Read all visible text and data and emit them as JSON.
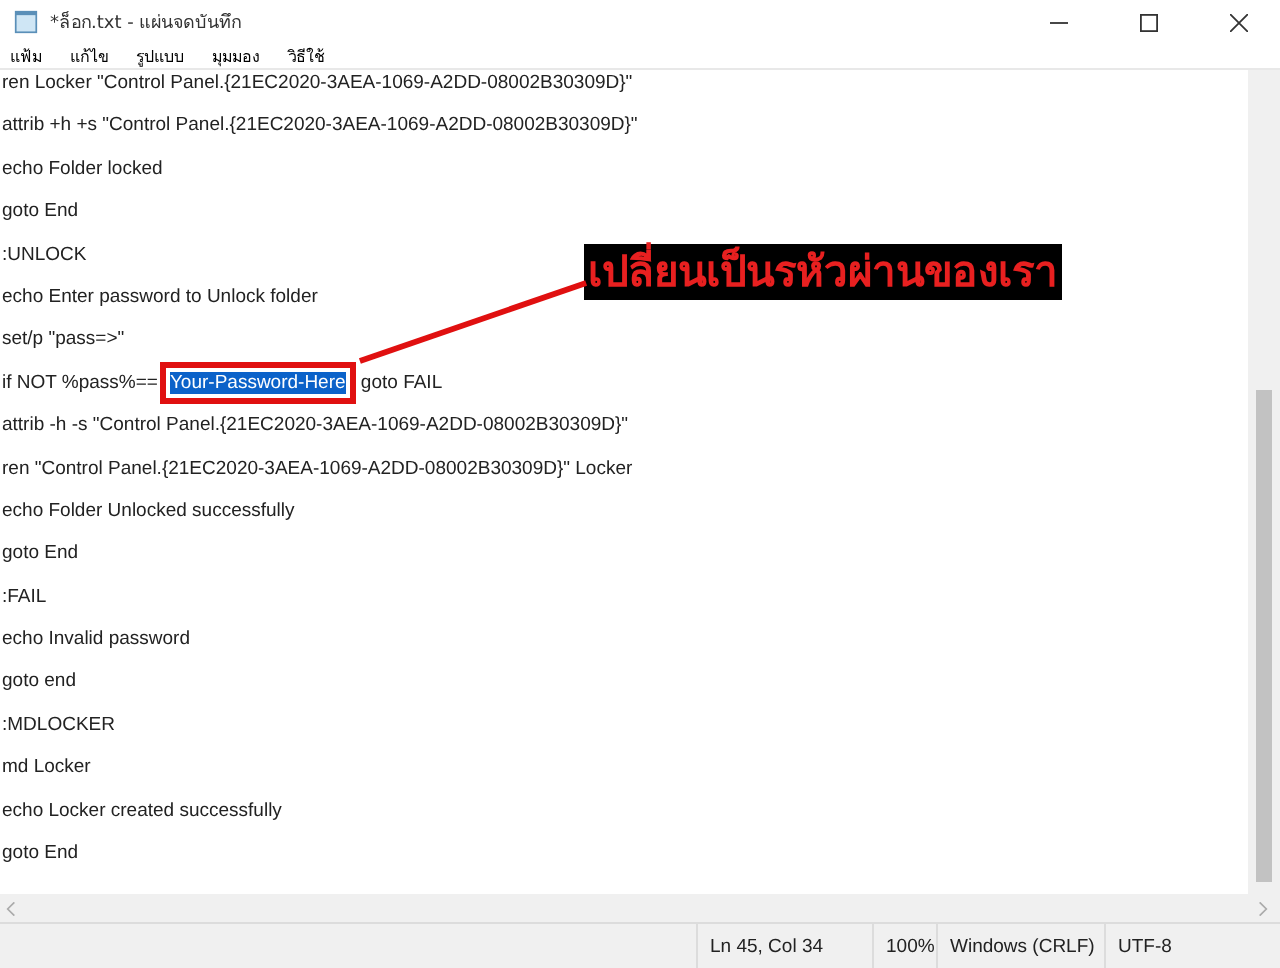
{
  "window": {
    "title": "*ล็อก.txt - แผ่นจดบันทึก"
  },
  "menu": [
    "แฟ้ม",
    "แก้ไข",
    "รูปแบบ",
    "มุมมอง",
    "วิธีใช้"
  ],
  "lines": [
    {
      "kind": "plain",
      "text": "ren Locker \"Control Panel.{21EC2020-3AEA-1069-A2DD-08002B30309D}\""
    },
    {
      "kind": "plain",
      "text": "attrib +h +s \"Control Panel.{21EC2020-3AEA-1069-A2DD-08002B30309D}\""
    },
    {
      "kind": "plain",
      "text": "echo Folder locked"
    },
    {
      "kind": "plain",
      "text": "goto End"
    },
    {
      "kind": "plain",
      "text": ":UNLOCK"
    },
    {
      "kind": "plain",
      "text": "echo Enter password to Unlock folder"
    },
    {
      "kind": "plain",
      "text": "set/p \"pass=>\""
    },
    {
      "kind": "selection",
      "before": "if NOT %pass%==",
      "selected": "Your-Password-Here",
      "after": " goto FAIL"
    },
    {
      "kind": "plain",
      "text": "attrib -h -s \"Control Panel.{21EC2020-3AEA-1069-A2DD-08002B30309D}\""
    },
    {
      "kind": "plain",
      "text": "ren \"Control Panel.{21EC2020-3AEA-1069-A2DD-08002B30309D}\" Locker"
    },
    {
      "kind": "plain",
      "text": "echo Folder Unlocked successfully"
    },
    {
      "kind": "plain",
      "text": "goto End"
    },
    {
      "kind": "plain",
      "text": ":FAIL"
    },
    {
      "kind": "plain",
      "text": "echo Invalid password"
    },
    {
      "kind": "plain",
      "text": "goto end"
    },
    {
      "kind": "plain",
      "text": ":MDLOCKER"
    },
    {
      "kind": "plain",
      "text": "md Locker"
    },
    {
      "kind": "plain",
      "text": "echo Locker created successfully"
    },
    {
      "kind": "plain",
      "text": "goto End"
    }
  ],
  "annotation": {
    "label": "เปลี่ยนเป็นรหัวผ่านของเรา"
  },
  "status_bar": {
    "position": "Ln 45, Col 34",
    "zoom": "100%",
    "line_ending": "Windows (CRLF)",
    "encoding": "UTF-8"
  }
}
